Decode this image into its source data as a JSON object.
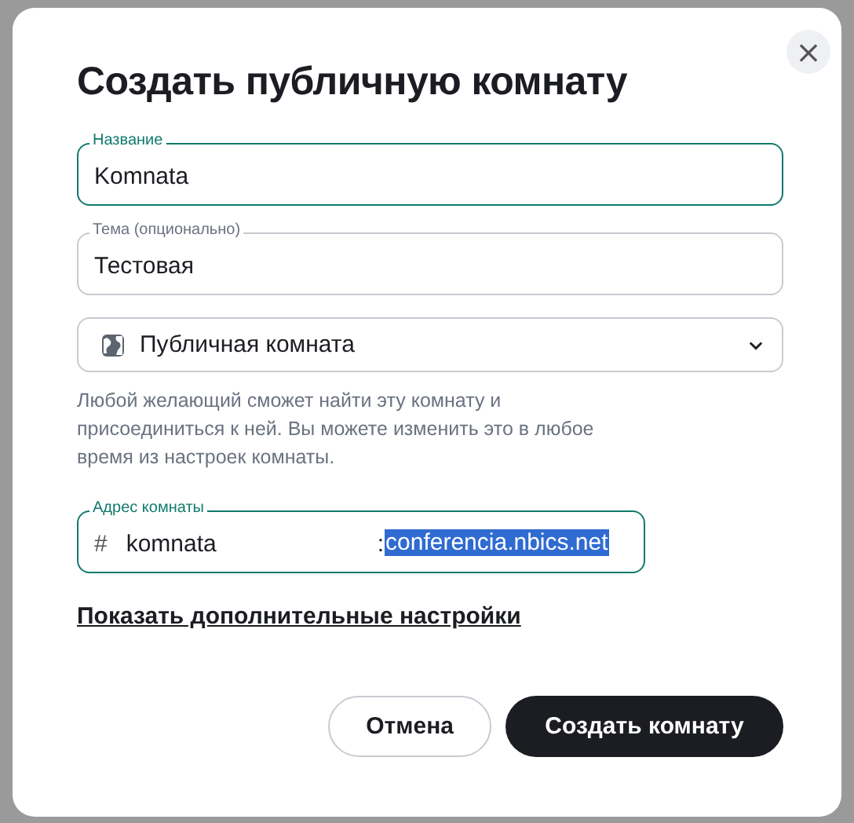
{
  "dialog": {
    "title": "Создать публичную комнату",
    "close": "×"
  },
  "fields": [
    {
      "label": "Название",
      "value": "Komnata",
      "focused": true
    },
    {
      "label": "Тема (опционально)",
      "value": "Тестовая",
      "focused": false
    }
  ],
  "visibility": {
    "value": "Публичная комната"
  },
  "description": "Любой желающий сможет найти эту комнату и присоединиться к ней. Вы можете изменить это в любое время из настроек комнаты.",
  "address": {
    "label": "Адрес комнаты",
    "prefix": "#",
    "value": "komnata",
    "separator": ":",
    "domain": "conferencia.nbics.net",
    "focused": true,
    "domain_selected": true
  },
  "advanced_link": "Показать дополнительные настройки",
  "buttons": [
    {
      "label": "Отмена",
      "kind": "secondary"
    },
    {
      "label": "Создать комнату",
      "kind": "primary"
    }
  ]
}
